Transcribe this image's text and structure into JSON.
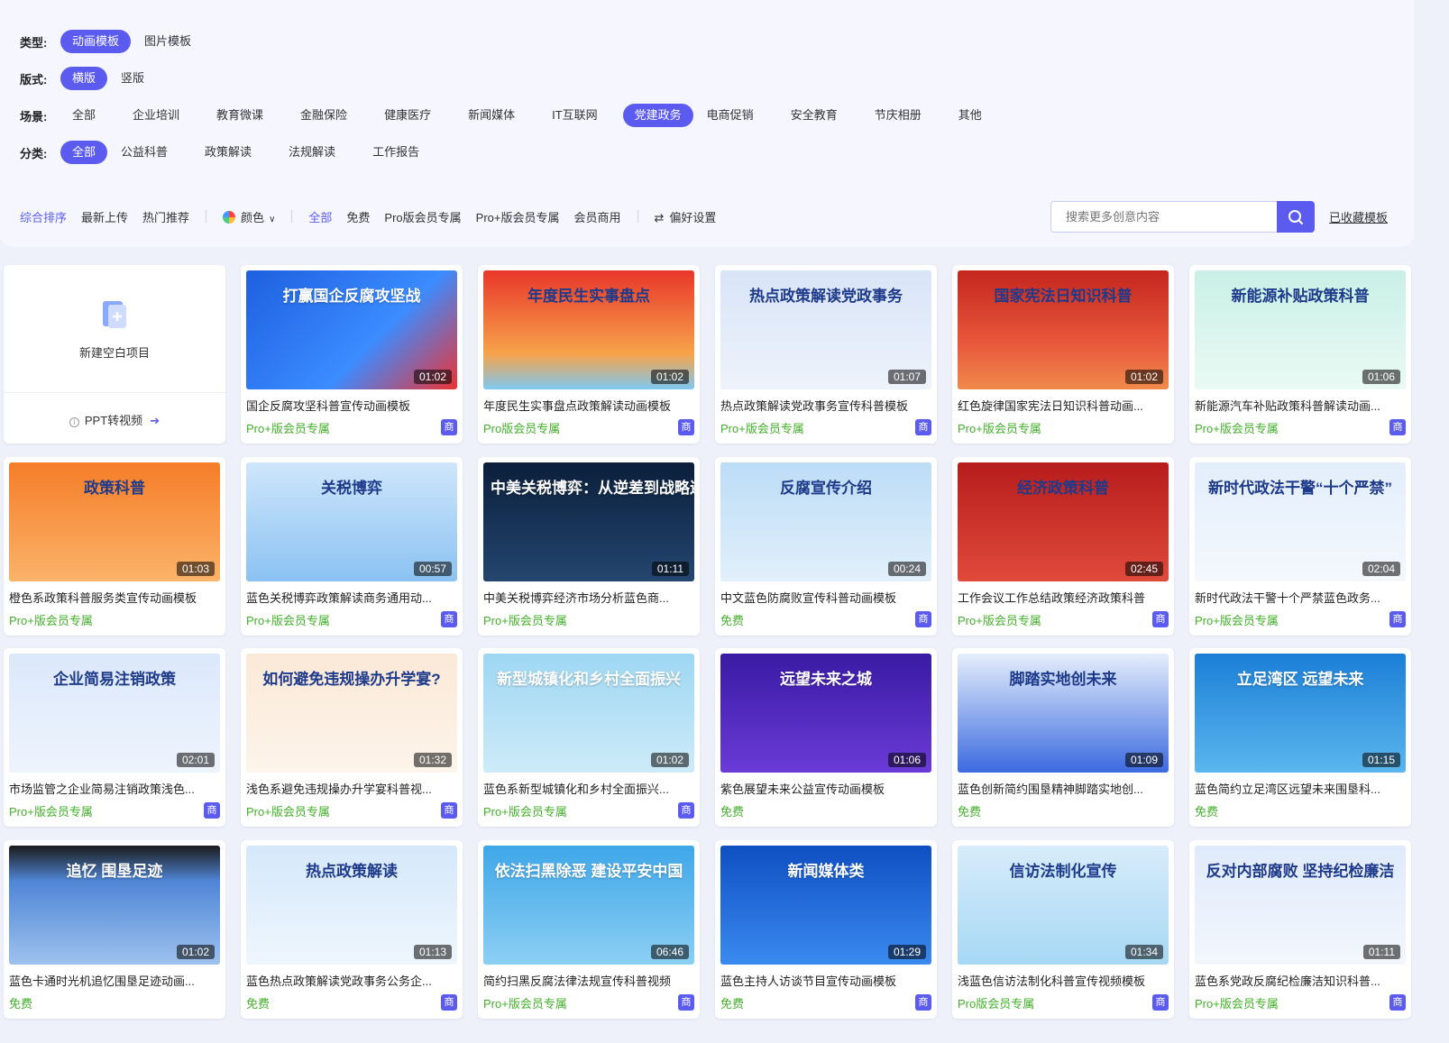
{
  "filters": {
    "type": {
      "label": "类型:",
      "options": [
        {
          "label": "动画模板",
          "active": true
        },
        {
          "label": "图片模板",
          "active": false
        }
      ]
    },
    "layout": {
      "label": "版式:",
      "options": [
        {
          "label": "横版",
          "active": true
        },
        {
          "label": "竖版",
          "active": false
        }
      ]
    },
    "scene": {
      "label": "场景:",
      "options": [
        {
          "label": "全部",
          "active": false
        },
        {
          "label": "企业培训",
          "active": false
        },
        {
          "label": "教育微课",
          "active": false
        },
        {
          "label": "金融保险",
          "active": false
        },
        {
          "label": "健康医疗",
          "active": false
        },
        {
          "label": "新闻媒体",
          "active": false
        },
        {
          "label": "IT互联网",
          "active": false
        },
        {
          "label": "党建政务",
          "active": true
        },
        {
          "label": "电商促销",
          "active": false
        },
        {
          "label": "安全教育",
          "active": false
        },
        {
          "label": "节庆相册",
          "active": false
        },
        {
          "label": "其他",
          "active": false
        }
      ]
    },
    "category": {
      "label": "分类:",
      "options": [
        {
          "label": "全部",
          "active": true
        },
        {
          "label": "公益科普",
          "active": false
        },
        {
          "label": "政策解读",
          "active": false
        },
        {
          "label": "法规解读",
          "active": false
        },
        {
          "label": "工作报告",
          "active": false
        }
      ]
    }
  },
  "sortbar": {
    "sorts": [
      {
        "label": "综合排序",
        "active": true
      },
      {
        "label": "最新上传",
        "active": false
      },
      {
        "label": "热门推荐",
        "active": false
      }
    ],
    "color_label": "颜色",
    "tiers": [
      {
        "label": "全部",
        "active": true
      },
      {
        "label": "免费",
        "active": false
      },
      {
        "label": "Pro版会员专属",
        "active": false
      },
      {
        "label": "Pro+版会员专属",
        "active": false
      },
      {
        "label": "会员商用",
        "active": false
      }
    ],
    "pref_label": "偏好设置"
  },
  "search": {
    "placeholder": "搜索更多创意内容"
  },
  "collected_label": "已收藏模板",
  "new_card": {
    "label": "新建空白项目",
    "ppt_label": "PPT转视频"
  },
  "shang_label": "商",
  "cards": [
    {
      "thumb_text": "打赢国企反腐攻坚战",
      "duration": "01:02",
      "title": "国企反腐攻坚科普宣传动画模板",
      "tag": "Pro+版会员专属",
      "shang": true,
      "bg": "linear-gradient(135deg,#1e5fe0,#3b8cff 60%,#e33 100%)"
    },
    {
      "thumb_text": "年度民生实事盘点",
      "duration": "01:02",
      "title": "年度民生实事盘点政策解读动画模板",
      "tag": "Pro版会员专属",
      "shang": true,
      "bg": "linear-gradient(180deg,#e8362a,#f7a34a 70%,#7ec8f0)"
    },
    {
      "thumb_text": "热点政策解读党政事务",
      "duration": "01:07",
      "title": "热点政策解读党政事务宣传科普模板",
      "tag": "Pro+版会员专属",
      "shang": true,
      "bg": "linear-gradient(180deg,#d8e4f7,#eef3fb)"
    },
    {
      "thumb_text": "国家宪法日知识科普",
      "duration": "01:02",
      "title": "红色旋律国家宪法日知识科普动画...",
      "tag": "Pro+版会员专属",
      "shang": false,
      "bg": "linear-gradient(180deg,#c4261d,#e8563b 60%,#f08a4b)"
    },
    {
      "thumb_text": "新能源补贴政策科普",
      "duration": "01:06",
      "title": "新能源汽车补贴政策科普解读动画...",
      "tag": "Pro+版会员专属",
      "shang": true,
      "bg": "linear-gradient(180deg,#c9f0e6,#eafaf4)"
    },
    {
      "thumb_text": "政策科普",
      "duration": "01:03",
      "title": "橙色系政策科普服务类宣传动画模板",
      "tag": "Pro+版会员专属",
      "shang": false,
      "bg": "linear-gradient(180deg,#f57d28,#fbb36a)"
    },
    {
      "thumb_text": "关税博弈",
      "duration": "00:57",
      "title": "蓝色关税博弈政策解读商务通用动...",
      "tag": "Pro+版会员专属",
      "shang": true,
      "bg": "linear-gradient(180deg,#cfe6fb,#8bc2f2)"
    },
    {
      "thumb_text": "中美关税博弈：从逆差到战略遏制",
      "duration": "01:11",
      "title": "中美关税博弈经济市场分析蓝色商...",
      "tag": "Pro+版会员专属",
      "shang": false,
      "bg": "linear-gradient(180deg,#0b1f3b,#24466f)"
    },
    {
      "thumb_text": "反腐宣传介绍",
      "duration": "00:24",
      "title": "中文蓝色防腐败宣传科普动画模板",
      "tag": "免费",
      "shang": true,
      "bg": "linear-gradient(180deg,#bcdcf6,#e2f0fb)"
    },
    {
      "thumb_text": "经济政策科普",
      "duration": "02:45",
      "title": "工作会议工作总结政策经济政策科普",
      "tag": "Pro+版会员专属",
      "shang": true,
      "bg": "linear-gradient(180deg,#b71c1c,#e04a3a)"
    },
    {
      "thumb_text": "新时代政法干警“十个严禁”",
      "duration": "02:04",
      "title": "新时代政法干警十个严禁蓝色政务...",
      "tag": "Pro+版会员专属",
      "shang": true,
      "bg": "linear-gradient(180deg,#e2eefb,#f4f8fd)"
    },
    {
      "thumb_text": "企业简易注销政策",
      "duration": "02:01",
      "title": "市场监管之企业简易注销政策浅色...",
      "tag": "Pro+版会员专属",
      "shang": true,
      "bg": "linear-gradient(180deg,#dbe8fb,#eef4fd)"
    },
    {
      "thumb_text": "如何避免违规操办升学宴?",
      "duration": "01:32",
      "title": "浅色系避免违规操办升学宴科普视...",
      "tag": "Pro+版会员专属",
      "shang": true,
      "bg": "linear-gradient(180deg,#fbe9d8,#fdf4ea)"
    },
    {
      "thumb_text": "新型城镇化和乡村全面振兴",
      "duration": "01:02",
      "title": "蓝色系新型城镇化和乡村全面振兴...",
      "tag": "Pro+版会员专属",
      "shang": true,
      "bg": "linear-gradient(180deg,#9ed7f3,#cdebf8)"
    },
    {
      "thumb_text": "远望未来之城",
      "duration": "01:06",
      "title": "紫色展望未来公益宣传动画模板",
      "tag": "免费",
      "shang": false,
      "bg": "linear-gradient(180deg,#3a1aa3,#6a3bd8)"
    },
    {
      "thumb_text": "脚踏实地创未来",
      "duration": "01:09",
      "title": "蓝色创新简约围垦精神脚踏实地创...",
      "tag": "免费",
      "shang": false,
      "bg": "linear-gradient(180deg,#e5eefc,#3c6be0)"
    },
    {
      "thumb_text": "立足湾区 远望未来",
      "duration": "01:15",
      "title": "蓝色简约立足湾区远望未来围垦科...",
      "tag": "免费",
      "shang": false,
      "bg": "linear-gradient(180deg,#1b7fd6,#5bb6ee)"
    },
    {
      "thumb_text": "追忆 围垦足迹",
      "duration": "01:02",
      "title": "蓝色卡通时光机追忆围垦足迹动画...",
      "tag": "免费",
      "shang": false,
      "bg": "linear-gradient(180deg,#1b1b1b,#4f86d6 30%,#9ec2ee)"
    },
    {
      "thumb_text": "热点政策解读",
      "duration": "01:13",
      "title": "蓝色热点政策解读党政事务公务企...",
      "tag": "免费",
      "shang": true,
      "bg": "linear-gradient(180deg,#d5e8fb,#eef6fd)"
    },
    {
      "thumb_text": "依法扫黑除恶 建设平安中国",
      "duration": "06:46",
      "title": "简约扫黑反腐法律法规宣传科普视频",
      "tag": "Pro+版会员专属",
      "shang": true,
      "bg": "linear-gradient(180deg,#3fa7e8,#8ccff4)"
    },
    {
      "thumb_text": "新闻媒体类",
      "duration": "01:29",
      "title": "蓝色主持人访谈节目宣传动画模板",
      "tag": "免费",
      "shang": true,
      "bg": "linear-gradient(180deg,#0f4fc2,#3a8af0)"
    },
    {
      "thumb_text": "信访法制化宣传",
      "duration": "01:34",
      "title": "浅蓝色信访法制化科普宣传视频模板",
      "tag": "Pro版会员专属",
      "shang": true,
      "bg": "linear-gradient(180deg,#d8ecfb,#a6d8f4)"
    },
    {
      "thumb_text": "反对内部腐败 坚持纪检廉洁",
      "duration": "01:11",
      "title": "蓝色系党政反腐纪检廉洁知识科普...",
      "tag": "Pro+版会员专属",
      "shang": true,
      "bg": "linear-gradient(180deg,#dfeafb,#f3f7fd)"
    }
  ]
}
